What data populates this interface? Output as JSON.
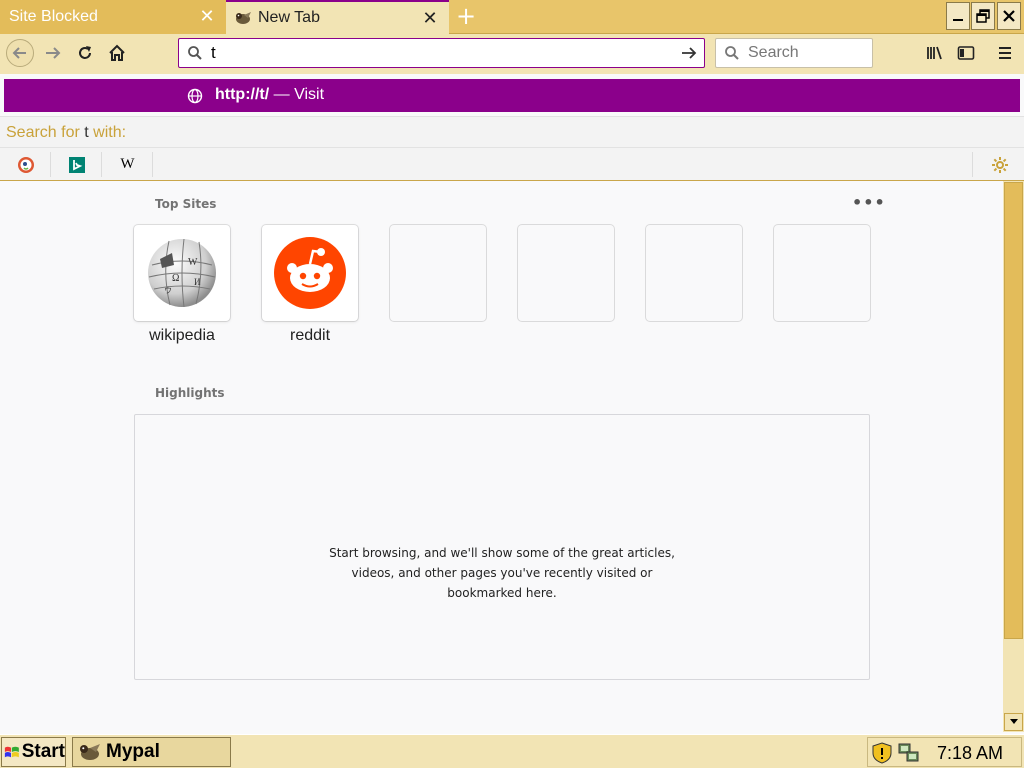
{
  "tabs": [
    {
      "title": "Site Blocked",
      "active": false
    },
    {
      "title": "New Tab",
      "active": true
    }
  ],
  "toolbar": {
    "url_value": "t",
    "search_placeholder": "Search"
  },
  "autocomplete": {
    "url": "http://t/",
    "separator": "—",
    "action": "Visit",
    "search_for_prefix": "Search for",
    "search_for_query": "t",
    "search_for_suffix": "with:",
    "engines": [
      "duckduckgo-icon",
      "bing-icon",
      "wikipedia-icon"
    ]
  },
  "newtab": {
    "top_sites_title": "Top Sites",
    "top_sites": [
      {
        "label": "wikipedia",
        "icon": "wikipedia-globe-icon"
      },
      {
        "label": "reddit",
        "icon": "reddit-icon"
      },
      {
        "label": ""
      },
      {
        "label": ""
      },
      {
        "label": ""
      },
      {
        "label": ""
      }
    ],
    "highlights_title": "Highlights",
    "highlights_msg_line1": "Start browsing, and we'll show some of the great articles,",
    "highlights_msg_line2": "videos, and other pages you've recently visited or",
    "highlights_msg_line3": "bookmarked here."
  },
  "taskbar": {
    "start_label": "Start",
    "task_label": "Mypal",
    "clock": "7:18 AM"
  },
  "colors": {
    "accent": "#8b008b",
    "tabbar": "#e8c56a",
    "toolbar": "#f2e4b4",
    "reddit": "#ff4500"
  }
}
